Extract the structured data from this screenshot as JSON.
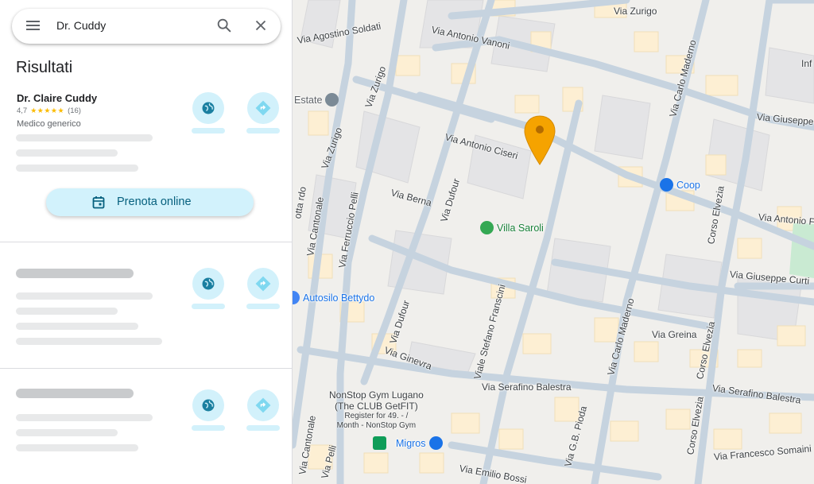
{
  "search": {
    "query": "Dr. Cuddy",
    "menu_icon": "hamburger-menu-icon",
    "search_icon": "search-icon",
    "close_icon": "close-icon"
  },
  "results_title": "Risultati",
  "results": [
    {
      "name": "Dr. Claire Cuddy",
      "rating": "4,7",
      "stars": "★★★★★",
      "reviews": "(16)",
      "category": "Medico generico",
      "actions": [
        "website-icon",
        "directions-icon"
      ],
      "book_label": "Prenota online",
      "book_icon": "calendar-icon"
    },
    {
      "placeholder": true,
      "actions": [
        "website-icon",
        "directions-icon"
      ]
    },
    {
      "placeholder": true,
      "actions": [
        "website-icon",
        "directions-icon"
      ]
    }
  ],
  "map": {
    "streets": {
      "via_zurigo_top": "Via Zurigo",
      "via_agostino_soldati": "Via Agostino Soldati",
      "via_antonio_vanoni": "Via Antonio Vanoni",
      "via_zurigo_left": "Via Zurigo",
      "via_zurigo_vert": "Via Zurigo",
      "via_carlo_maderno_top": "Via Carlo Maderno",
      "via_giuseppe_top": "Via Giuseppe",
      "via_antonio_ciseri": "Via Antonio Ciseri",
      "via_berna": "Via Berna",
      "via_dufour_top": "Via Dufour",
      "via_ferruccio_pelli": "Via Ferruccio Pelli",
      "via_cantonale": "Via Cantonale",
      "via_cantonale_bottom": "Via Cantonale",
      "corso_elvezia_top": "Corso Elvezia",
      "via_antonio_fusoni": "Via Antonio Fus",
      "via_giuseppe_curti": "Via Giuseppe Curti",
      "via_dufour_bottom": "Via Dufour",
      "viale_stefano_franscini": "Viale Stefano Franscini",
      "via_carlo_maderno_bottom": "Via Carlo Maderno",
      "via_greina": "Via Greina",
      "corso_elvezia_mid": "Corso Elvezia",
      "via_ginevra": "Via Ginevra",
      "via_serafino_balestra": "Via Serafino Balestra",
      "via_serafino_balestra_right": "Via Serafino Balestra",
      "via_gb_pioda": "Via G.B. Pioda",
      "corso_elvezia_bottom": "Corso Elvezia",
      "via_francesco_somaini": "Via Francesco Somaini",
      "via_emilio_bossi": "Via Emilio Bossi",
      "via_pelli_bottom": "Via Pelli",
      "via_sottocenere": "otta rdo"
    },
    "pois": {
      "estate": "Estate",
      "coop": "Coop",
      "villa_saroli": "Villa Saroli",
      "autosilo": "Autosilo Bettydo",
      "gym_name": "NonStop Gym Lugano",
      "gym_sub": "(The CLUB GetFIT)",
      "gym_desc1": "Register for 49. - /",
      "gym_desc2": "Month - NonStop Gym",
      "migros": "Migros",
      "inf": "Inf"
    },
    "colors": {
      "road": "#c8d4e0",
      "building": "#fdefd3",
      "block": "#e8e8e8",
      "park": "#c9ead2",
      "pin": "#f5a300"
    }
  }
}
